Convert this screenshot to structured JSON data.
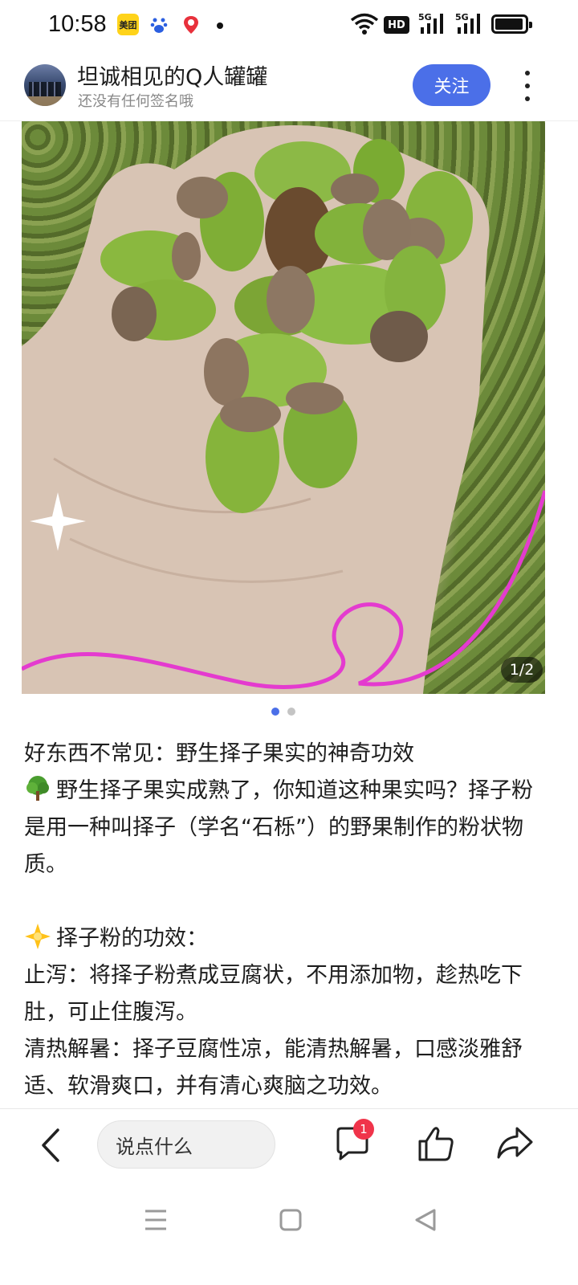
{
  "status_bar": {
    "time": "10:58",
    "app_badges": [
      "美团",
      "百度",
      "地图"
    ],
    "network": [
      "HD",
      "5G",
      "5G"
    ],
    "battery_level_percent": 95
  },
  "header": {
    "username": "坦诚相见的Q人罐罐",
    "signature": "还没有任何签名哦",
    "follow_label": "关注"
  },
  "gallery": {
    "counter": "1/2",
    "current_page": 1,
    "total_pages": 2,
    "active_dot_color": "#4b6fe8"
  },
  "article": {
    "title": "好东西不常见：野生择子果实的神奇功效",
    "intro": "野生择子果实成熟了，你知道这种果实吗？择子粉是用一种叫择子（学名“石栎”）的野果制作的粉状物质。",
    "section_heading": "择子粉的功效：",
    "items": [
      "止泻：将择子粉煮成豆腐状，不用添加物，趁热吃下肚，可止住腹泻。",
      "清热解暑：择子豆腐性凉，能清热解暑，口感淡雅舒适、软滑爽口，并有清心爽脑之功效。"
    ],
    "icons": [
      "tree-emoji",
      "star-emoji"
    ]
  },
  "bottom_bar": {
    "comment_placeholder": "说点什么",
    "comment_badge": "1"
  },
  "accent_color": "#4b6fe8"
}
